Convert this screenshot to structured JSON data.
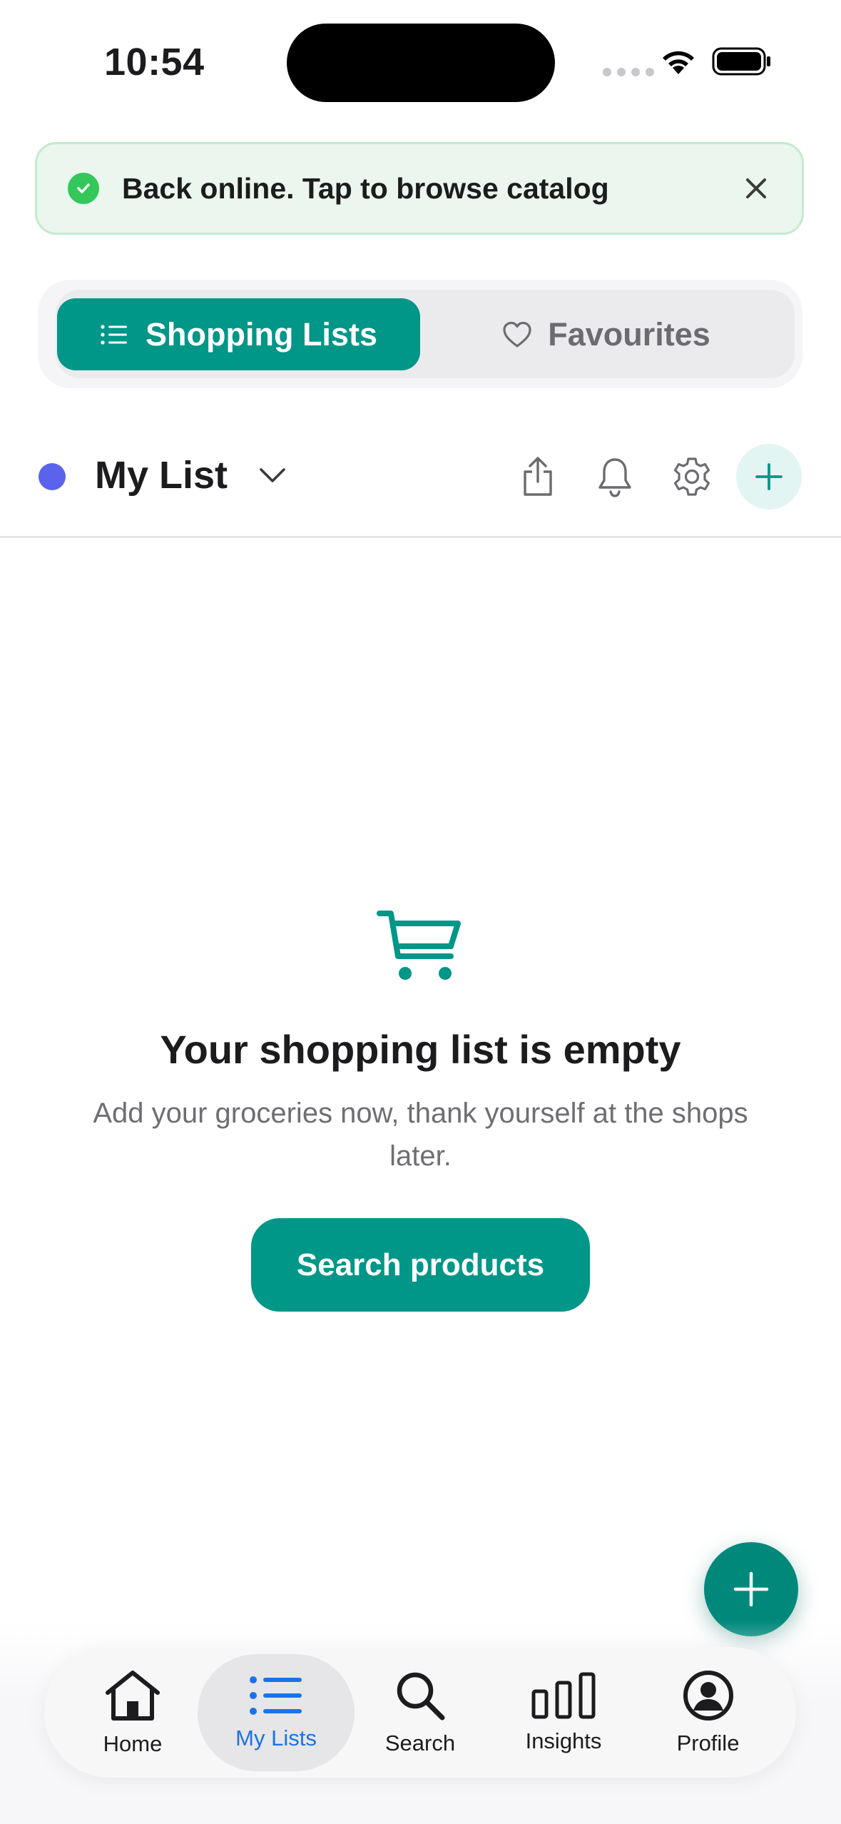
{
  "status_bar": {
    "time": "10:54"
  },
  "toast": {
    "message": "Back online. Tap to browse catalog"
  },
  "segments": {
    "active": "Shopping Lists",
    "inactive": "Favourites"
  },
  "list": {
    "name": "My List",
    "dot_color": "#5b63ec"
  },
  "empty_state": {
    "title": "Your shopping list is empty",
    "subtitle": "Add your groceries now, thank yourself at the shops later.",
    "cta_label": "Search products"
  },
  "colors": {
    "accent": "#009688",
    "success": "#34c759",
    "nav_active": "#1a73e8"
  },
  "nav": {
    "items": [
      {
        "label": "Home",
        "icon": "home-icon"
      },
      {
        "label": "My Lists",
        "icon": "list-icon",
        "active": true
      },
      {
        "label": "Search",
        "icon": "search-icon"
      },
      {
        "label": "Insights",
        "icon": "bar-chart-icon"
      },
      {
        "label": "Profile",
        "icon": "profile-icon"
      }
    ]
  }
}
